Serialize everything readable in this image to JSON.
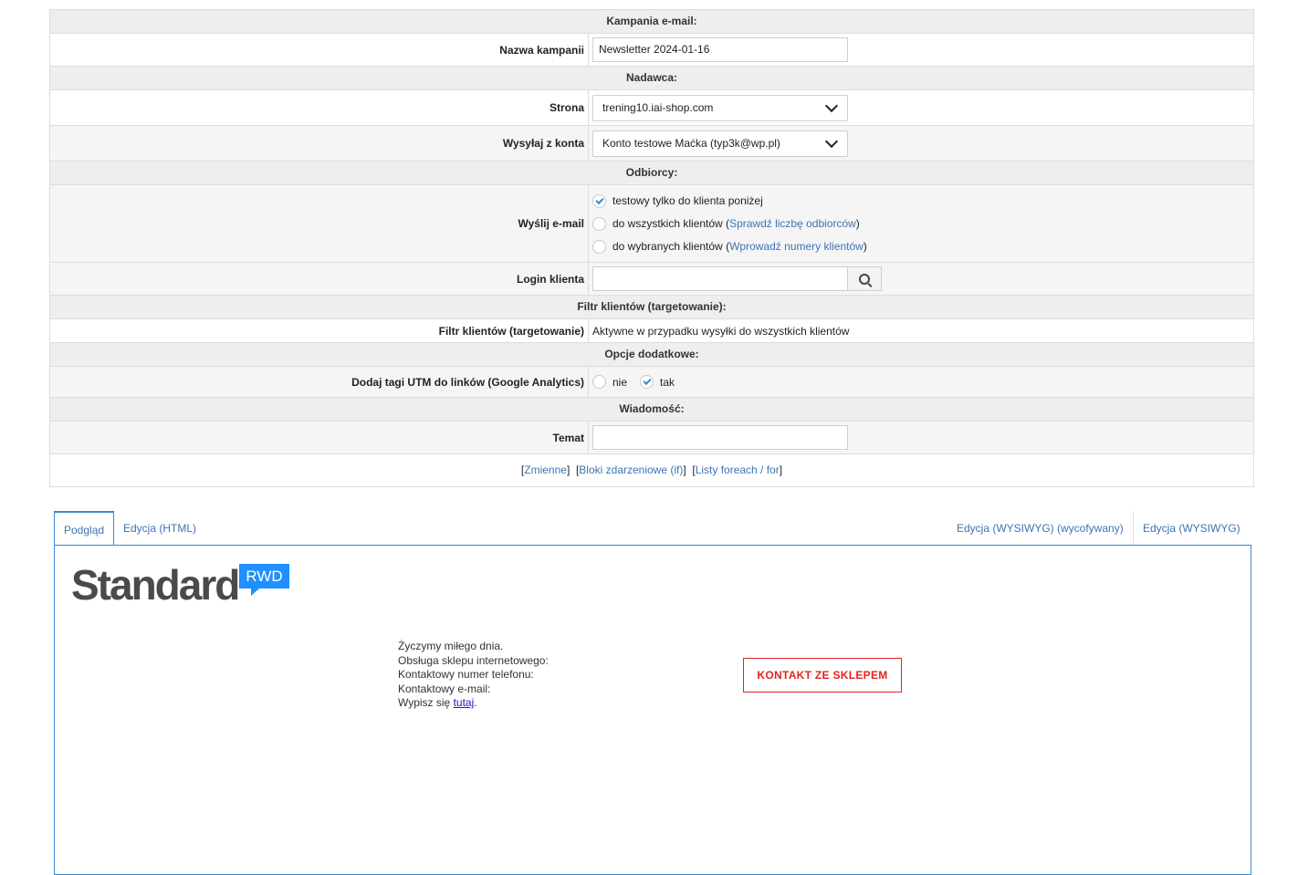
{
  "campaign": {
    "section_title": "Kampania e-mail:",
    "name_label": "Nazwa kampanii",
    "name_value": "Newsletter 2024-01-16"
  },
  "sender": {
    "section_title": "Nadawca:",
    "site_label": "Strona",
    "site_value": "trening10.iai-shop.com",
    "account_label": "Wysyłaj z konta",
    "account_value": "Konto testowe Maćka (typ3k@wp.pl)"
  },
  "recipients": {
    "section_title": "Odbiorcy:",
    "send_label": "Wyślij e-mail",
    "options": [
      {
        "label": "testowy tylko do klienta poniżej",
        "checked": true
      },
      {
        "label": "do wszystkich klientów",
        "link": "Sprawdź liczbę odbiorców",
        "checked": false
      },
      {
        "label": "do wybranych klientów",
        "link": "Wprowadź numery klientów",
        "checked": false
      }
    ],
    "login_label": "Login klienta",
    "login_value": ""
  },
  "filter": {
    "section_title": "Filtr klientów (targetowanie):",
    "label": "Filtr klientów (targetowanie)",
    "value": "Aktywne w przypadku wysyłki do wszystkich klientów"
  },
  "extra": {
    "section_title": "Opcje dodatkowe:",
    "utm_label": "Dodaj tagi UTM do linków (Google Analytics)",
    "no_label": "nie",
    "yes_label": "tak",
    "utm_selected": "tak"
  },
  "message": {
    "section_title": "Wiadomość:",
    "subject_label": "Temat",
    "subject_value": "",
    "links": {
      "variables": "Zmienne",
      "event_blocks": "Bloki zdarzeniowe (if)",
      "foreach": "Listy foreach / for"
    }
  },
  "tabs": {
    "preview": "Podgląd",
    "html": "Edycja (HTML)",
    "wysiwyg_old": "Edycja (WYSIWYG) (wycofywany)",
    "wysiwyg": "Edycja (WYSIWYG)"
  },
  "preview": {
    "logo_text": "Standard",
    "logo_badge": "RWD",
    "line1": "Życzymy miłego dnia.",
    "line2": "Obsługa sklepu internetowego:",
    "line3": "Kontaktowy numer telefonu:",
    "line4": "Kontaktowy e-mail:",
    "unsubscribe_prefix": "Wypisz się",
    "unsubscribe_link": "tutaj",
    "contact_button": "KONTAKT ZE SKLEPEM"
  },
  "colors": {
    "accent": "#3a8ad0",
    "link": "#3d74b3",
    "contact_red": "#e02424",
    "badge_blue": "#1e90ff"
  }
}
